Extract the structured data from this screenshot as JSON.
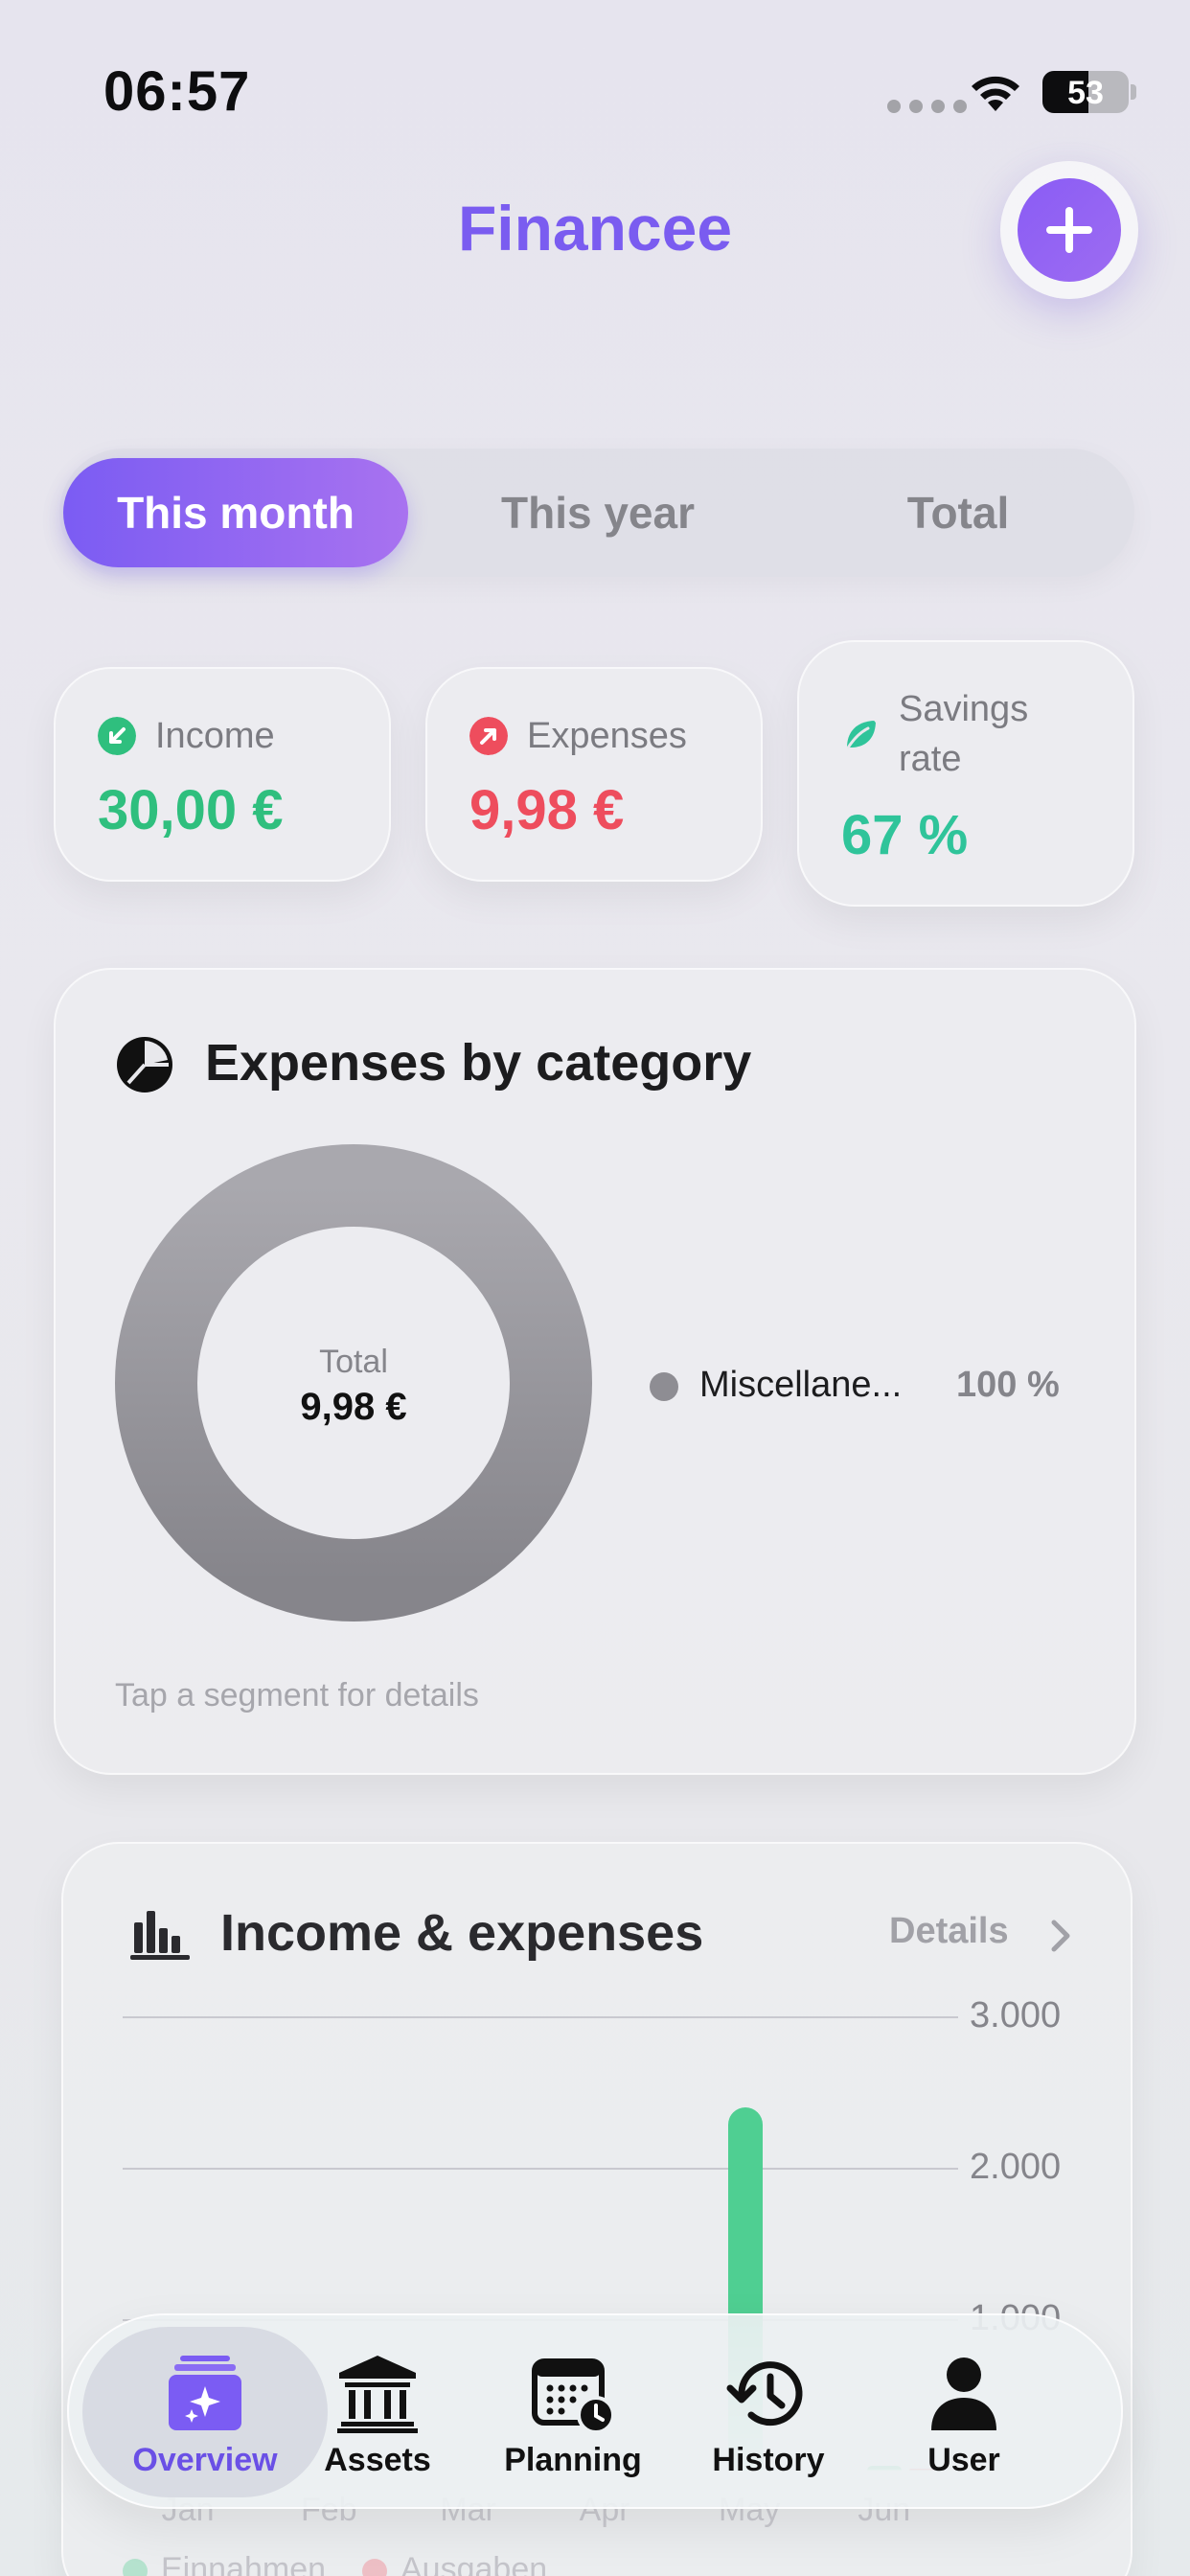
{
  "status_bar": {
    "time": "06:57",
    "battery": "53"
  },
  "header": {
    "title": "Financee",
    "add_icon": "plus-icon"
  },
  "period_tabs": [
    "This month",
    "This year",
    "Total"
  ],
  "summary": {
    "income": {
      "label": "Income",
      "value": "30,00 €",
      "icon": "arrow-down-left-icon",
      "color": "#2fbf7e"
    },
    "expenses": {
      "label": "Expenses",
      "value": "9,98 €",
      "icon": "arrow-up-right-icon",
      "color": "#ee4d5d"
    },
    "savings": {
      "label": "Savings rate",
      "value": "67 %",
      "icon": "leaf-icon",
      "color": "#2fc49a"
    }
  },
  "expenses_by_category": {
    "title": "Expenses by category",
    "total_label": "Total",
    "total_value": "9,98 €",
    "legend": [
      {
        "name": "Miscellane...",
        "percent": "100 %",
        "color": "#8e8d93"
      }
    ],
    "hint": "Tap a segment for details"
  },
  "income_expenses": {
    "title": "Income & expenses",
    "details_label": "Details",
    "chart_data": {
      "type": "bar",
      "categories": [
        "Jan",
        "Feb",
        "Mar",
        "Apr",
        "May",
        "Jun"
      ],
      "series": [
        {
          "name": "Einnahmen",
          "values": [
            0,
            0,
            0,
            0,
            2400,
            30
          ],
          "color": "#4fcf92"
        },
        {
          "name": "Ausgaben",
          "values": [
            0,
            0,
            0,
            0,
            0,
            10
          ],
          "color": "#f06b78"
        }
      ],
      "y_ticks": [
        "3.000",
        "2.000",
        "1.000"
      ],
      "ylim": [
        0,
        3000
      ]
    }
  },
  "tab_bar": [
    {
      "label": "Overview",
      "icon": "sparkle-card-icon",
      "active": true
    },
    {
      "label": "Assets",
      "icon": "bank-icon",
      "active": false
    },
    {
      "label": "Planning",
      "icon": "calendar-clock-icon",
      "active": false
    },
    {
      "label": "History",
      "icon": "history-clock-icon",
      "active": false
    },
    {
      "label": "User",
      "icon": "person-icon",
      "active": false
    }
  ]
}
